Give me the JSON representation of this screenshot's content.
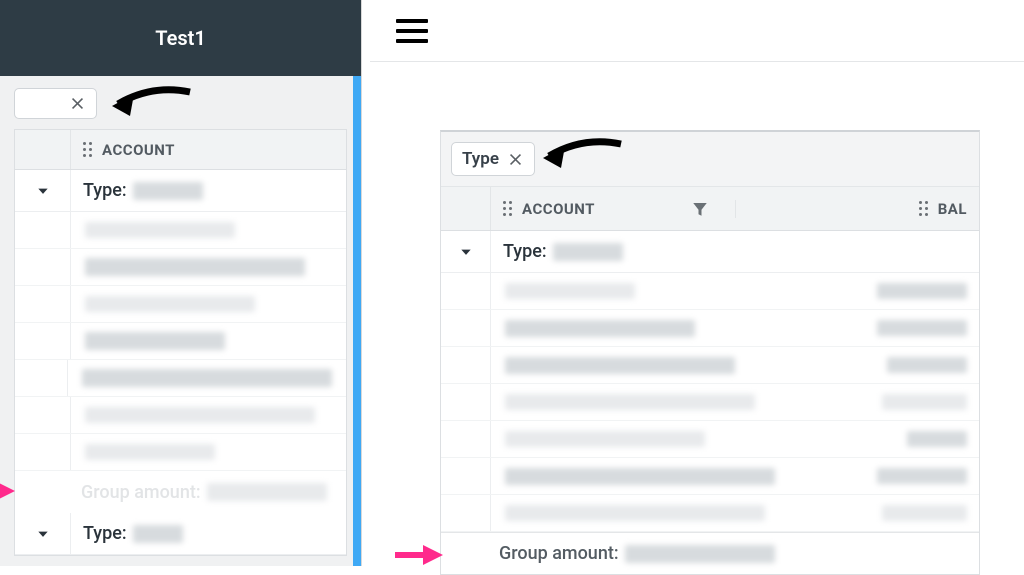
{
  "leftPanel": {
    "title": "Test1",
    "columns": {
      "account": "ACCOUNT"
    },
    "groups": [
      {
        "labelPrefix": "Type:",
        "rowCount": 7,
        "footerLabel": "Group amount:"
      },
      {
        "labelPrefix": "Type:"
      }
    ]
  },
  "main": {
    "chip": {
      "label": "Type"
    },
    "columns": {
      "account": "ACCOUNT",
      "bal": "BAL"
    },
    "groups": [
      {
        "labelPrefix": "Type:",
        "rowCount": 7,
        "footerLabel": "Group amount:"
      }
    ]
  }
}
